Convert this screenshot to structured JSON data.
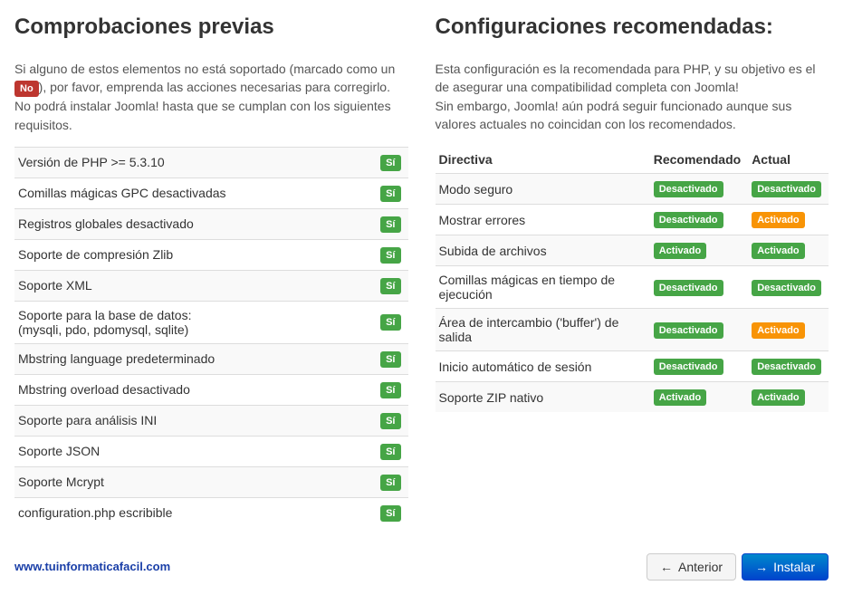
{
  "left": {
    "title": "Comprobaciones previas",
    "intro_pre": "Si alguno de estos elementos no está soportado (marcado como un ",
    "intro_badge": "No",
    "intro_post": "), por favor, emprenda las acciones necesarias para corregirlo. No podrá instalar Joomla! hasta que se cumplan con los siguientes requisitos.",
    "yes_label": "Sí",
    "rows": [
      {
        "label": "Versión de PHP >= 5.3.10"
      },
      {
        "label": "Comillas mágicas GPC desactivadas"
      },
      {
        "label": "Registros globales desactivado"
      },
      {
        "label": "Soporte de compresión Zlib"
      },
      {
        "label": "Soporte XML"
      },
      {
        "label": "Soporte para la base de datos:",
        "sub": "(mysqli, pdo, pdomysql, sqlite)"
      },
      {
        "label": "Mbstring language predeterminado"
      },
      {
        "label": "Mbstring overload desactivado"
      },
      {
        "label": "Soporte para análisis INI"
      },
      {
        "label": "Soporte JSON"
      },
      {
        "label": "Soporte Mcrypt"
      },
      {
        "label": "configuration.php escribible"
      }
    ]
  },
  "right": {
    "title": "Configuraciones recomendadas:",
    "intro1": "Esta configuración es la recomendada para PHP, y su objetivo es el de asegurar una compatibilidad completa con Joomla!",
    "intro2": "Sin embargo, Joomla! aún podrá seguir funcionado aunque sus valores actuales no coincidan con los recomendados.",
    "headers": {
      "directive": "Directiva",
      "recommended": "Recomendado",
      "actual": "Actual"
    },
    "labels": {
      "on": "Activado",
      "off": "Desactivado"
    },
    "rows": [
      {
        "label": "Modo seguro",
        "rec": "off",
        "act": "off",
        "match": true
      },
      {
        "label": "Mostrar errores",
        "rec": "off",
        "act": "on",
        "match": false
      },
      {
        "label": "Subida de archivos",
        "rec": "on",
        "act": "on",
        "match": true
      },
      {
        "label": "Comillas mágicas en tiempo de ejecución",
        "rec": "off",
        "act": "off",
        "match": true
      },
      {
        "label": "Área de intercambio ('buffer') de salida",
        "rec": "off",
        "act": "on",
        "match": false
      },
      {
        "label": "Inicio automático de sesión",
        "rec": "off",
        "act": "off",
        "match": true
      },
      {
        "label": "Soporte ZIP nativo",
        "rec": "on",
        "act": "on",
        "match": true
      }
    ]
  },
  "footer": {
    "watermark": "www.tuinformaticafacil.com",
    "prev": "Anterior",
    "install": "Instalar"
  }
}
